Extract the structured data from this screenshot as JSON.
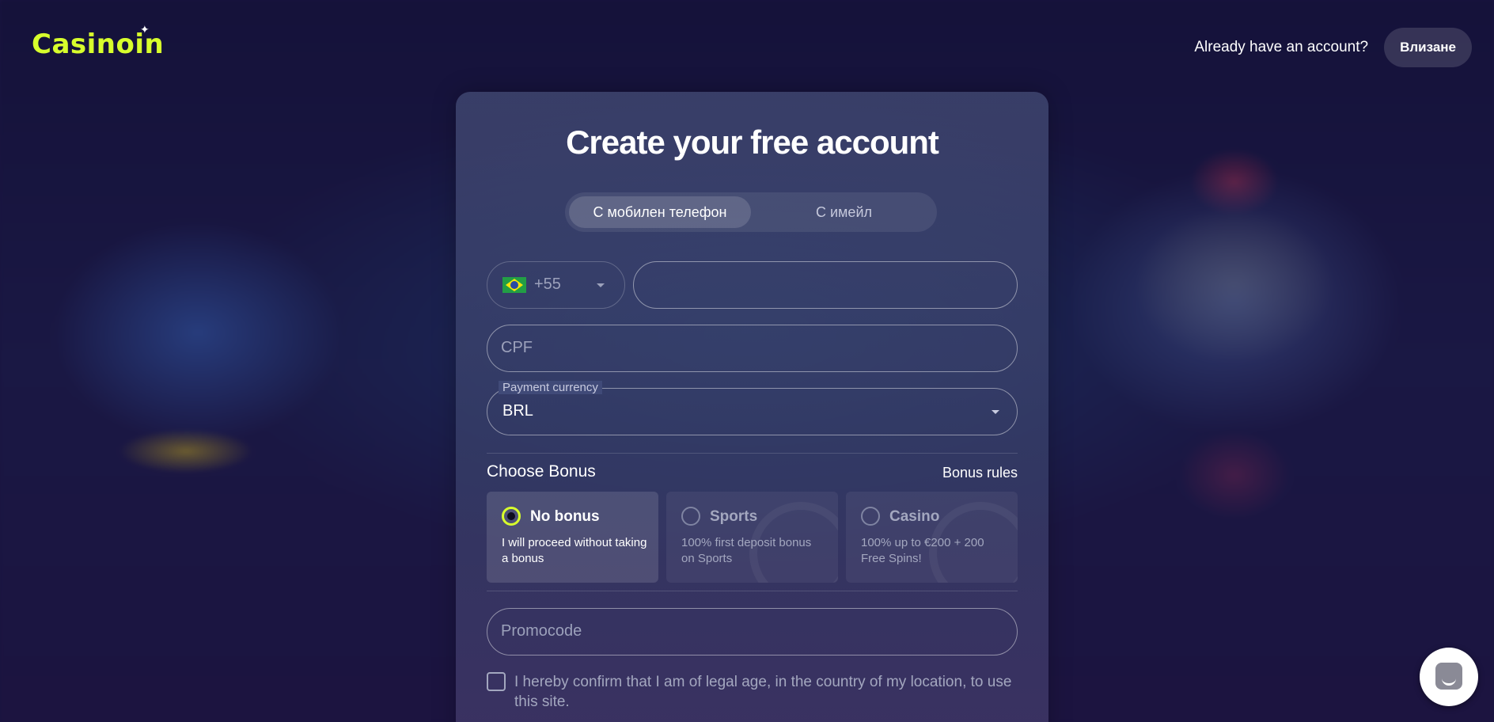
{
  "header": {
    "logo_text": "Casinoin",
    "already_text": "Already have an account?",
    "login_label": "Влизане"
  },
  "form": {
    "title": "Create your free account",
    "tabs": [
      {
        "label": "С мобилен телефон",
        "active": true
      },
      {
        "label": "С имейл",
        "active": false
      }
    ],
    "phone": {
      "country_flag": "brazil-flag-icon",
      "dial_code": "+55",
      "number_value": ""
    },
    "cpf": {
      "placeholder": "CPF",
      "value": ""
    },
    "currency": {
      "legend": "Payment currency",
      "value": "BRL"
    },
    "bonus": {
      "heading": "Choose Bonus",
      "rules_label": "Bonus rules",
      "options": [
        {
          "name": "No bonus",
          "description": "I will proceed without taking a bonus",
          "selected": true
        },
        {
          "name": "Sports",
          "description": "100% first deposit bonus on Sports",
          "selected": false
        },
        {
          "name": "Casino",
          "description": "100% up to €200 + 200 Free Spins!",
          "selected": false
        }
      ]
    },
    "promocode": {
      "placeholder": "Promocode",
      "value": ""
    },
    "agreement": {
      "checked": false,
      "text": "I hereby confirm that I am of legal age, in the country of my location, to use this site."
    }
  },
  "chat": {
    "icon": "chat-bubble-icon"
  },
  "colors": {
    "accent": "#d8ff2c",
    "background": "#1a1540",
    "card": "#3e4674"
  }
}
